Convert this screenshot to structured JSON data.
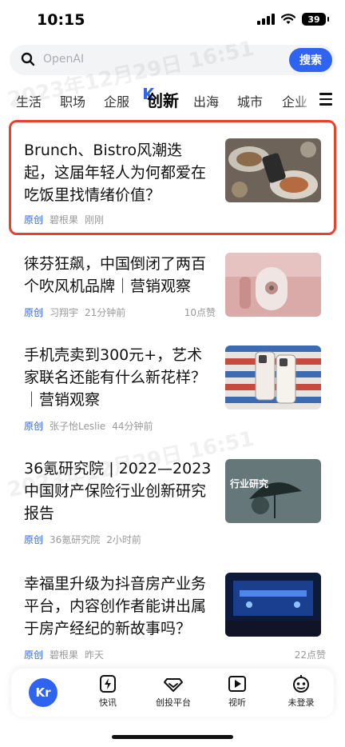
{
  "status": {
    "time": "10:15",
    "battery": "39"
  },
  "search": {
    "placeholder": "OpenAI",
    "button": "搜索"
  },
  "watermark": "2023年12月29日 16:51",
  "tabs": [
    "生活",
    "职场",
    "企服",
    "创新",
    "出海",
    "城市",
    "企业"
  ],
  "active_tab": "创新",
  "articles": [
    {
      "title": "Brunch、Bistro风潮迭起，这届年轻人为何都爱在吃饭里找情绪价值？",
      "origin": "原创",
      "author": "碧根果",
      "time": "刚刚",
      "likes": "",
      "thumb": "food-photo"
    },
    {
      "title": "徕芬狂飙，中国倒闭了两百个吹风机品牌｜营销观察",
      "origin": "原创",
      "author": "习翔宇",
      "time": "21分钟前",
      "likes": "10点赞",
      "thumb": "hairdryer-photo"
    },
    {
      "title": "手机壳卖到300元+，艺术家联名还能有什么新花样？｜营销观察",
      "origin": "原创",
      "author": "张子怡Leslie",
      "time": "44分钟前",
      "likes": "",
      "thumb": "phonecase-photo"
    },
    {
      "title": "36氪研究院 | 2022—2023中国财产保险行业创新研究报告",
      "origin": "原创",
      "author": "36氪研究院",
      "time": "2小时前",
      "likes": "",
      "thumb": "insurance-report",
      "thumb_text": "行业研究"
    },
    {
      "title": "幸福里升级为抖音房产业务平台，内容创作者能讲出属于房产经纪的新故事吗？",
      "origin": "原创",
      "author": "碧根果",
      "time": "昨天",
      "likes": "22点赞",
      "thumb": "stage-photo"
    }
  ],
  "bottom_nav": {
    "logo": "Kr",
    "items": [
      {
        "label": "快讯",
        "icon": "flash-icon"
      },
      {
        "label": "创投平台",
        "icon": "diamond-icon"
      },
      {
        "label": "视听",
        "icon": "play-icon"
      },
      {
        "label": "未登录",
        "icon": "robot-icon"
      }
    ]
  },
  "colors": {
    "accent": "#2f63f2",
    "highlight": "#e8412c"
  }
}
